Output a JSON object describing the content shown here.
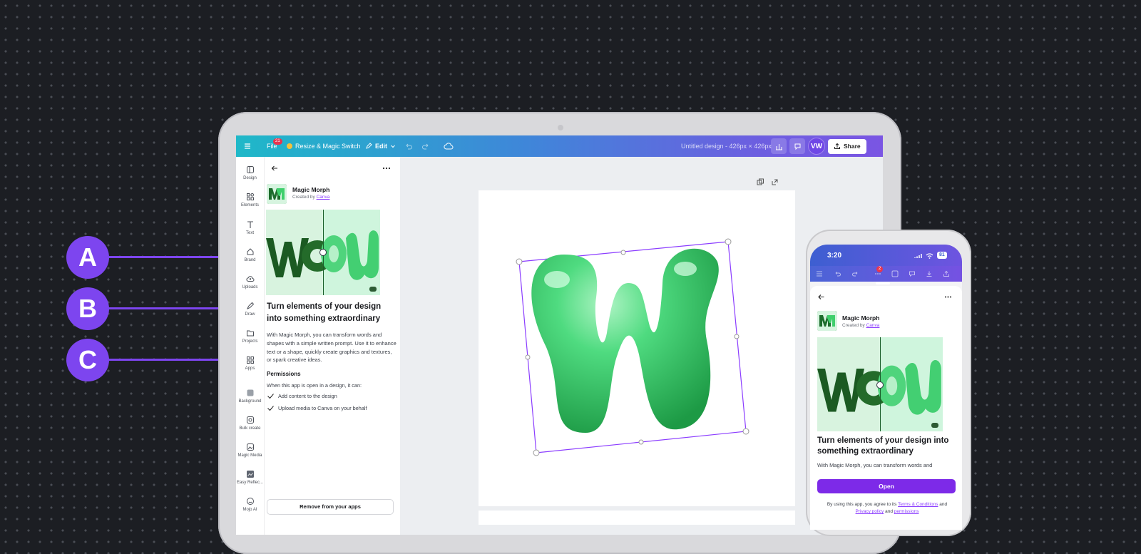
{
  "callouts": [
    "A",
    "B",
    "C"
  ],
  "topbar": {
    "file_label": "File",
    "file_badge": "21",
    "resize_label": "Resize & Magic Switch",
    "edit_label": "Edit",
    "doc_title": "Untitled design - 426px × 426px",
    "avatar_initials": "VW",
    "share_label": "Share"
  },
  "rail": {
    "items": [
      "Design",
      "Elements",
      "Text",
      "Brand",
      "Uploads",
      "Draw",
      "Projects",
      "Apps",
      "Background",
      "Bulk create",
      "Magic Media",
      "Easy Reflec...",
      "Mojo AI"
    ]
  },
  "panel": {
    "app_name": "Magic Morph",
    "created_by_prefix": "Created by",
    "created_by_link": "Canva",
    "headline": "Turn elements of your design into something extraordinary",
    "description": "With Magic Morph, you can transform words and shapes with a simple written prompt. Use it to enhance text or a shape, quickly create graphics and textures, or spark creative ideas.",
    "permissions_title": "Permissions",
    "permissions_intro": "When this app is open in a design, it can:",
    "permissions": [
      "Add content to the design",
      "Upload media to Canva on your behalf"
    ],
    "remove_button": "Remove from your apps",
    "preview_text": "Wo"
  },
  "phone": {
    "time": "3:20",
    "battery": "81",
    "toolbar_badge": "2",
    "app_name": "Magic Morph",
    "created_by_prefix": "Created by",
    "created_by_link": "Canva",
    "headline": "Turn elements of your design into something extraordinary",
    "description_visible": "With Magic Morph, you can transform words and",
    "open_button": "Open",
    "terms_prefix": "By using this app, you agree to its",
    "terms_link": "Terms & Conditions",
    "terms_and": "and",
    "privacy_link": "Privacy policy",
    "permissions_link": "permissions",
    "preview_text": "Wo"
  },
  "colors": {
    "accent": "#7d45ef",
    "canva_purple": "#8b3dff",
    "morph_green": "#3fcf6c"
  }
}
